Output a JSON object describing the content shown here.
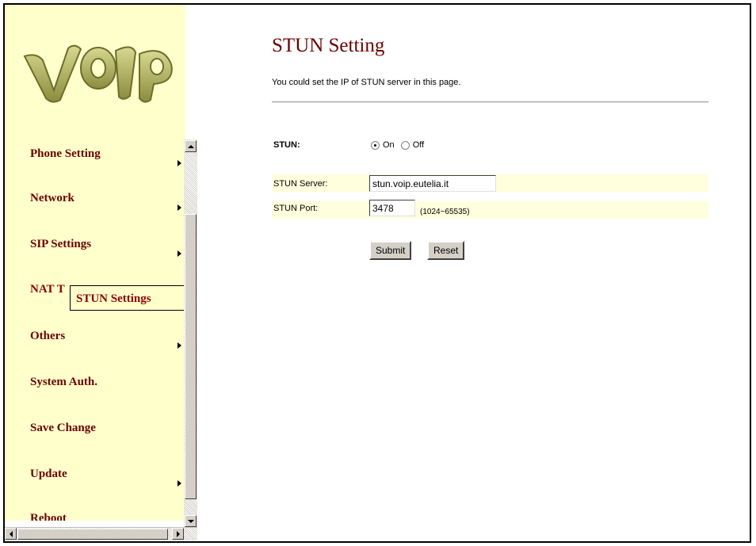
{
  "logo": {
    "text": "VoIP"
  },
  "sidebar": {
    "items": [
      {
        "label": "Phone Setting",
        "has_submenu": true
      },
      {
        "label": "Network",
        "has_submenu": true
      },
      {
        "label": "SIP Settings",
        "has_submenu": true
      },
      {
        "label": "NAT T",
        "has_submenu": false
      },
      {
        "label": "Others",
        "has_submenu": true
      },
      {
        "label": "System Auth.",
        "has_submenu": false
      },
      {
        "label": "Save Change",
        "has_submenu": false
      },
      {
        "label": "Update",
        "has_submenu": true
      },
      {
        "label": "Reboot",
        "has_submenu": false
      }
    ],
    "submenu": {
      "label": "STUN Settings"
    }
  },
  "page": {
    "title": "STUN Setting",
    "description": "You could set the IP of STUN server in this page."
  },
  "form": {
    "stun_label": "STUN:",
    "stun_options": [
      {
        "label": "On",
        "checked": true
      },
      {
        "label": "Off",
        "checked": false
      }
    ],
    "server_label": "STUN Server:",
    "server_value": "stun.voip.eutelia.it",
    "port_label": "STUN Port:",
    "port_value": "3478",
    "port_range": "(1024~65535)",
    "submit_label": "Submit",
    "reset_label": "Reset"
  },
  "colors": {
    "sidebar_bg": "#ffffcc",
    "menu_text": "#6b0000",
    "title_text": "#6b0000",
    "row_bg": "#ffffdd"
  }
}
